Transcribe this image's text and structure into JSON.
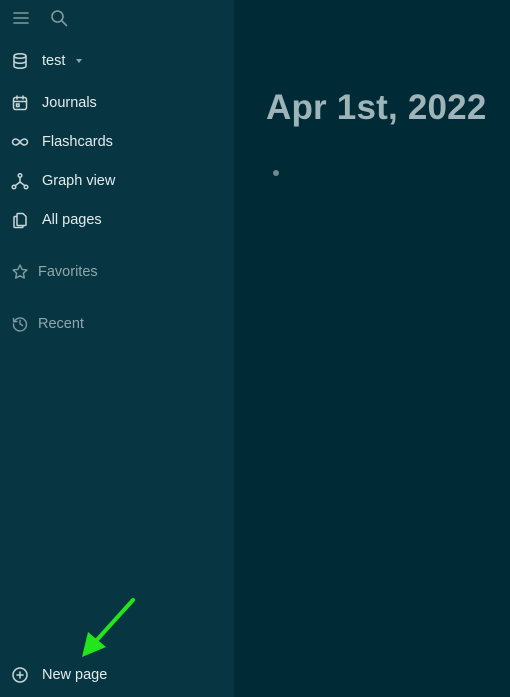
{
  "sidebar": {
    "graph_name": "test",
    "nav": [
      {
        "label": "Journals",
        "icon": "calendar-icon"
      },
      {
        "label": "Flashcards",
        "icon": "infinity-icon"
      },
      {
        "label": "Graph view",
        "icon": "graph-icon"
      },
      {
        "label": "All pages",
        "icon": "pages-icon"
      }
    ],
    "favorites_label": "Favorites",
    "recent_label": "Recent",
    "new_page_label": "New page"
  },
  "main": {
    "page_title": "Apr 1st, 2022"
  },
  "colors": {
    "sidebar_bg": "#073642",
    "main_bg": "#002b36",
    "annotation_arrow": "#22e61b"
  }
}
